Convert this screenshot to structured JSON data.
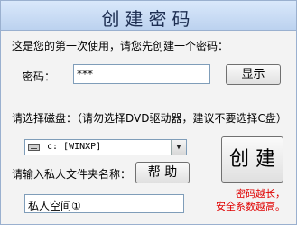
{
  "window": {
    "title": "创建密码"
  },
  "intro": "这是您的第一次使用，请您先创建一个密码：",
  "password": {
    "label": "密码：",
    "value": "***",
    "show_button": "显示"
  },
  "disk": {
    "label": "请选择磁盘：（请勿选择DVD驱动器，建议不要选择C盘）",
    "selected": "c: [WINXP]"
  },
  "folder": {
    "label": "请输入私人文件夹名称：",
    "help_button": "帮 助",
    "value": "私人空间①"
  },
  "create_button": "创 建",
  "hint": {
    "line1": "密码越长，",
    "line2": "安全系数越高。"
  },
  "colors": {
    "title_bar": "#c8dcf5",
    "hint_text": "#e00000"
  }
}
